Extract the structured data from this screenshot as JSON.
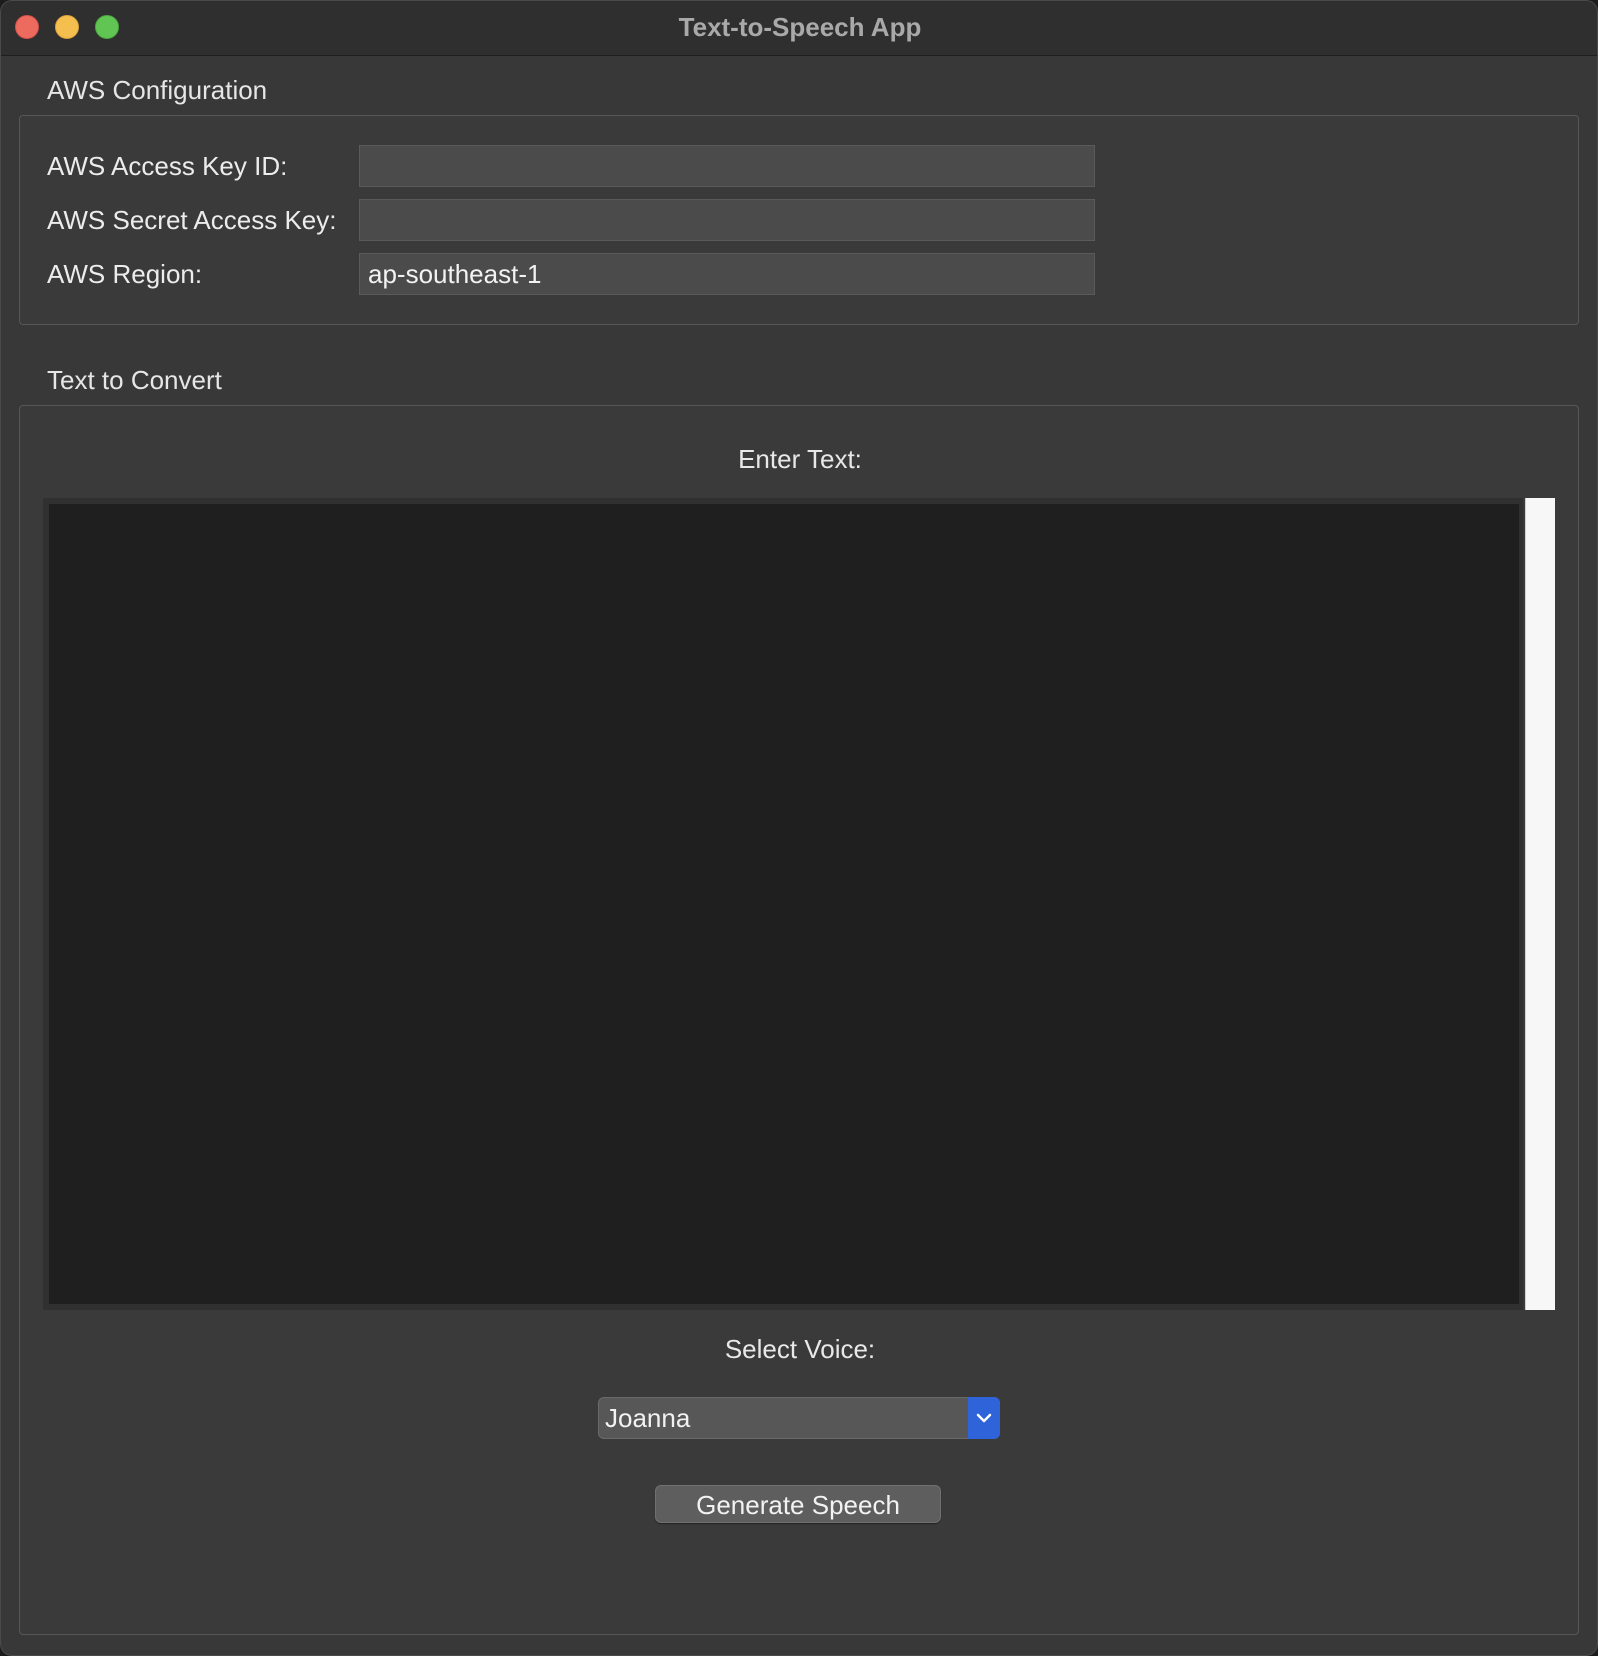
{
  "window": {
    "title": "Text-to-Speech App"
  },
  "aws_config": {
    "section_title": "AWS Configuration",
    "fields": [
      {
        "label": "AWS Access Key ID:",
        "value": "",
        "placeholder": ""
      },
      {
        "label": "AWS Secret Access Key:",
        "value": "",
        "placeholder": ""
      },
      {
        "label": "AWS Region:",
        "value": "ap-southeast-1",
        "placeholder": ""
      }
    ]
  },
  "text_section": {
    "section_title": "Text to Convert",
    "enter_text_label": "Enter Text:",
    "text_value": "",
    "select_voice_label": "Select Voice:",
    "selected_voice": "Joanna",
    "generate_button_label": "Generate Speech"
  },
  "colors": {
    "window_bg": "#383838",
    "titlebar_bg": "#2f2f2f",
    "accent": "#2e63d9",
    "close": "#ed6a5e",
    "minimize": "#f5bf4f",
    "zoom": "#61c554"
  },
  "icons": {
    "select_arrow": "chevron-down-icon"
  }
}
